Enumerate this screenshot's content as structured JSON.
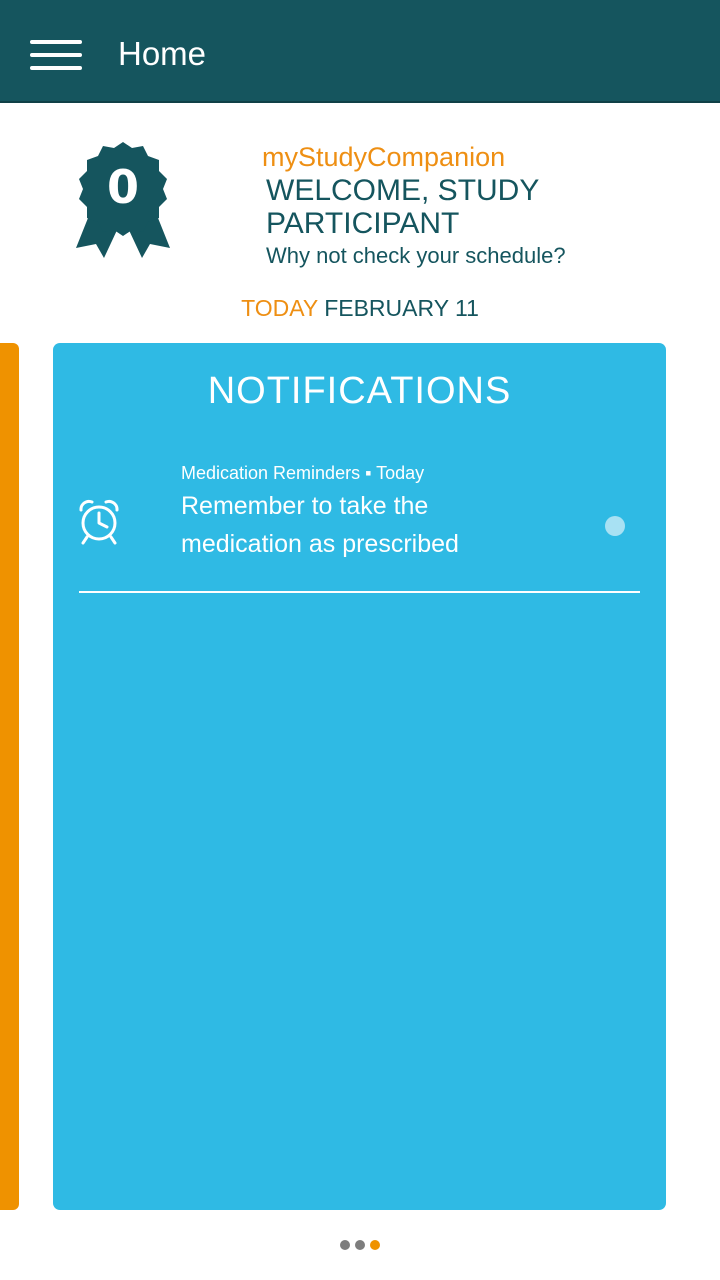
{
  "appbar": {
    "title": "Home",
    "menu_icon": "hamburger-menu-icon"
  },
  "badge": {
    "count": "0",
    "icon": "award-ribbon-icon"
  },
  "welcome": {
    "brand": "myStudyCompanion",
    "heading": "WELCOME, STUDY PARTICIPANT",
    "subline": "Why not check your schedule?"
  },
  "date": {
    "today_label": "TODAY",
    "value": "FEBRUARY 11"
  },
  "notifications": {
    "title": "NOTIFICATIONS",
    "items": [
      {
        "icon": "alarm-clock-icon",
        "meta": "Medication Reminders ▪ Today",
        "body": "Remember to take the medication as prescribed",
        "unread": true
      }
    ]
  },
  "pager": {
    "count": 3,
    "active_index": 2
  },
  "colors": {
    "appbar": "#15555e",
    "accent_orange": "#ee8f13",
    "card_blue": "#2fbae4",
    "text_teal": "#15555e"
  }
}
